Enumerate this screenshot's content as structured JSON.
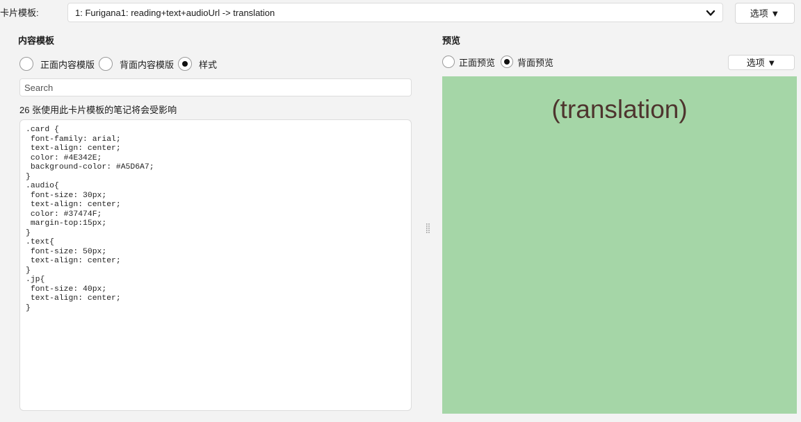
{
  "header": {
    "template_label": "卡片模板:",
    "template_selected": "1: Furigana1: reading+text+audioUrl -> translation",
    "options_label": "选项 ▼"
  },
  "content_panel": {
    "heading": "内容模板",
    "radios": [
      {
        "label": "正面内容模版",
        "checked": false
      },
      {
        "label": "背面内容模版",
        "checked": false
      },
      {
        "label": "样式",
        "checked": true
      }
    ],
    "search_placeholder": "Search",
    "affected_note": "26 张使用此卡片模板的笔记将会受影响",
    "css_text": ".card {\n font-family: arial;\n text-align: center;\n color: #4E342E;\n background-color: #A5D6A7;\n}\n.audio{\n font-size: 30px;\n text-align: center;\n color: #37474F;\n margin-top:15px;\n}\n.text{\n font-size: 50px;\n text-align: center;\n}\n.jp{\n font-size: 40px;\n text-align: center;\n}"
  },
  "preview_panel": {
    "heading": "预览",
    "radios": [
      {
        "label": "正面预览",
        "checked": false
      },
      {
        "label": "背面预览",
        "checked": true
      }
    ],
    "options_label": "选项 ▼",
    "card_text": "(translation)"
  },
  "colors": {
    "card_background": "#A5D6A7",
    "card_text": "#4E342E",
    "window_background": "#f3f3f3"
  },
  "icons": {
    "dropdown": "chevron-down-icon",
    "splitter": "drag-handle-icon"
  }
}
